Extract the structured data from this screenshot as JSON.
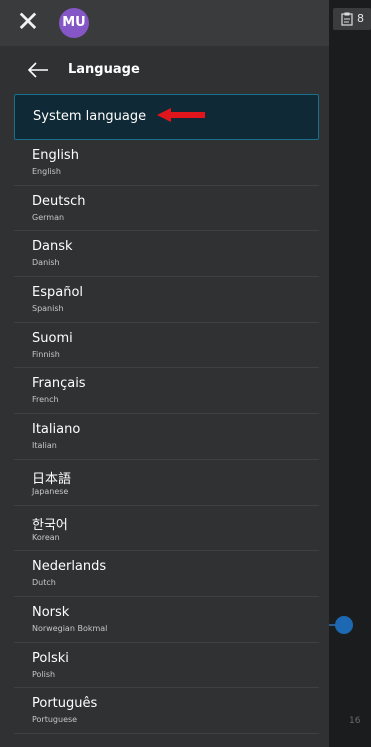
{
  "header": {
    "avatar_initials": "MU"
  },
  "panel": {
    "title": "Language"
  },
  "languages": [
    {
      "name": "System language",
      "selected": true
    },
    {
      "name": "English",
      "sub": "English"
    },
    {
      "name": "Deutsch",
      "sub": "German"
    },
    {
      "name": "Dansk",
      "sub": "Danish"
    },
    {
      "name": "Español",
      "sub": "Spanish"
    },
    {
      "name": "Suomi",
      "sub": "Finnish"
    },
    {
      "name": "Français",
      "sub": "French"
    },
    {
      "name": "Italiano",
      "sub": "Italian"
    },
    {
      "name": "日本語",
      "sub": "Japanese"
    },
    {
      "name": "한국어",
      "sub": "Korean"
    },
    {
      "name": "Nederlands",
      "sub": "Dutch"
    },
    {
      "name": "Norsk",
      "sub": "Norwegian Bokmal"
    },
    {
      "name": "Polski",
      "sub": "Polish"
    },
    {
      "name": "Português",
      "sub": "Portuguese"
    }
  ],
  "right_panel": {
    "count": "8",
    "bottom_text": "16"
  },
  "colors": {
    "selected_border": "#1a6f8c",
    "avatar": "#8456c6",
    "annotation_arrow": "#e0161c"
  },
  "icons": [
    "close-icon",
    "back-arrow-icon",
    "clipboard-icon",
    "red-annotation-arrow"
  ]
}
